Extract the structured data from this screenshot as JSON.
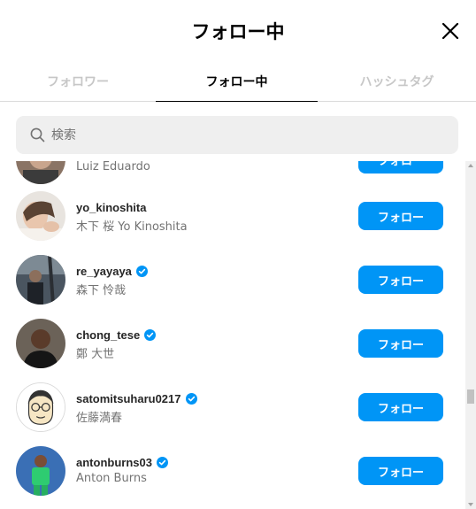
{
  "header": {
    "title": "フォロー中",
    "close_icon": "close-icon"
  },
  "tabs": [
    {
      "label": "フォロワー",
      "active": false
    },
    {
      "label": "フォロー中",
      "active": true
    },
    {
      "label": "ハッシュタグ",
      "active": false
    }
  ],
  "search": {
    "placeholder": "検索",
    "value": ""
  },
  "colors": {
    "accent": "#0095f6",
    "verified": "#0095f6",
    "text": "#262626",
    "muted": "#737373"
  },
  "users": [
    {
      "username": "",
      "full_name": "Luiz Eduardo",
      "verified": false,
      "button": "フォロー"
    },
    {
      "username": "yo_kinoshita",
      "full_name": "木下 桜 Yo Kinoshita",
      "verified": false,
      "button": "フォロー"
    },
    {
      "username": "re_yayaya",
      "full_name": "森下 怜哉",
      "verified": true,
      "button": "フォロー"
    },
    {
      "username": "chong_tese",
      "full_name": "鄭 大世",
      "verified": true,
      "button": "フォロー"
    },
    {
      "username": "satomitsuharu0217",
      "full_name": "佐藤満春",
      "verified": true,
      "button": "フォロー"
    },
    {
      "username": "antonburns03",
      "full_name": "Anton Burns",
      "verified": true,
      "button": "フォロー"
    }
  ]
}
